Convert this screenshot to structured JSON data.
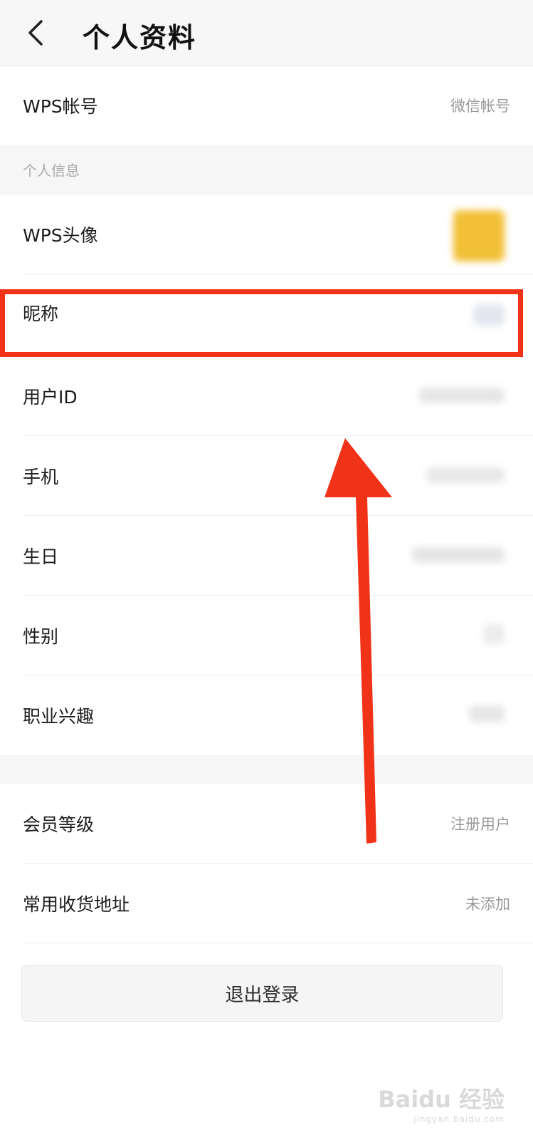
{
  "header": {
    "title": "个人资料",
    "back_icon": "chevron-left-icon"
  },
  "account": {
    "label": "WPS帐号",
    "value": "微信帐号"
  },
  "section_personal": {
    "title": "个人信息"
  },
  "avatar": {
    "label": "WPS头像",
    "color": "#f2c037"
  },
  "nickname": {
    "label": "昵称"
  },
  "user_id": {
    "label": "用户ID"
  },
  "phone": {
    "label": "手机"
  },
  "birthday": {
    "label": "生日"
  },
  "gender": {
    "label": "性别"
  },
  "occupation": {
    "label": "职业兴趣"
  },
  "membership": {
    "label": "会员等级",
    "value": "注册用户"
  },
  "address": {
    "label": "常用收货地址",
    "value": "未添加"
  },
  "logout": {
    "label": "退出登录"
  },
  "annotation": {
    "highlight_color": "#f03218",
    "arrow_color": "#f03218"
  },
  "watermark": {
    "brand": "Baidu 经验",
    "url": "jingyan.baidu.com"
  }
}
